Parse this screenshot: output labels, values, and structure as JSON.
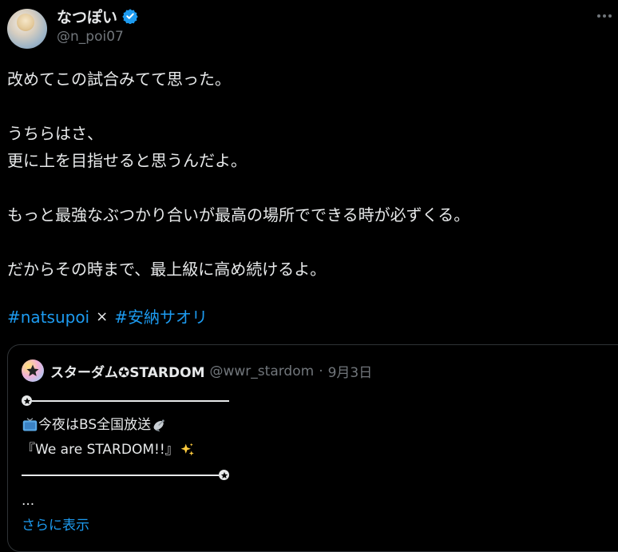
{
  "author": {
    "display_name": "なつぽい",
    "handle": "@n_poi07"
  },
  "tweet": {
    "lines": [
      "改めてこの試合みてて思った。",
      "",
      "うちらはさ、",
      "更に上を目指せると思うんだよ。",
      "",
      "もっと最強なぶつかり合いが最高の場所でできる時が必ずくる。",
      "",
      "だからその時まで、最上級に高め続けるよ。"
    ],
    "hashtag_1": "#natsupoi",
    "separator": "×",
    "hashtag_2": "#安納サオリ"
  },
  "quoted": {
    "name": "スターダム✪STARDOM",
    "handle": "@wwr_stardom",
    "dot": "·",
    "date": "9月3日",
    "line_2": "今夜はBS全国放送",
    "line_3": "『We are STARDOM!!』",
    "ellipsis": "...",
    "show_more": "さらに表示"
  },
  "colors": {
    "background": "#000000",
    "text": "#e7e9ea",
    "muted": "#71767b",
    "link": "#1d9bf0",
    "border": "#2f3336",
    "verified": "#1d9bf0"
  },
  "icons": [
    "verified-icon",
    "more-icon",
    "tv-icon",
    "satellite-dish-icon",
    "sparkles-icon",
    "star-badge-icon"
  ]
}
